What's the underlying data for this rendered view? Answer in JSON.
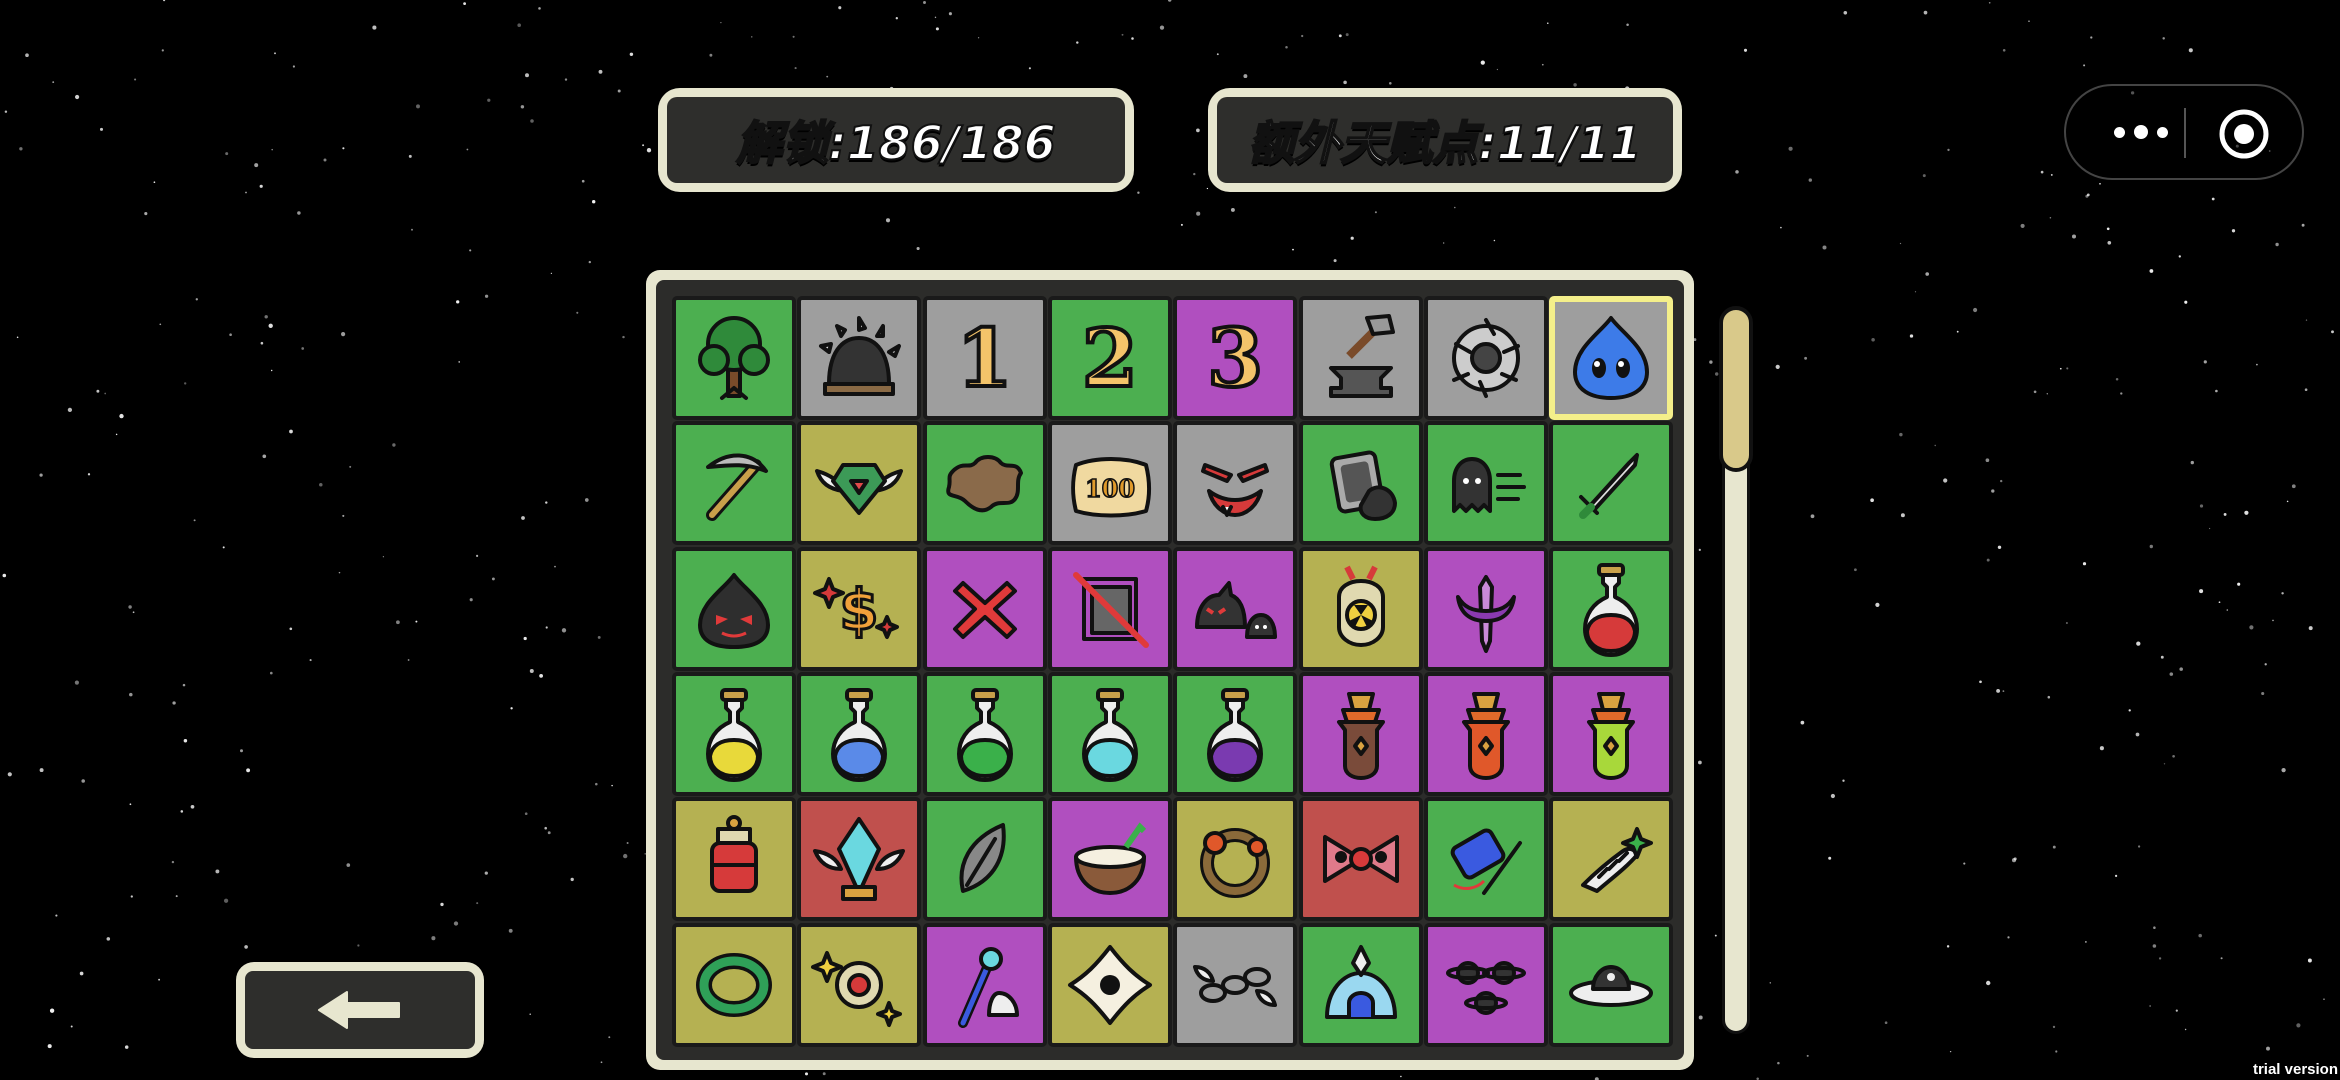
{
  "header": {
    "unlock_label": "解锁:186/186",
    "talent_label": "额外天赋点:11/11"
  },
  "colors": {
    "green": "#4caf50",
    "gray": "#9e9e9e",
    "purple": "#b04fbf",
    "olive": "#b5b152",
    "red": "#c0504d",
    "panel": "#e7e6cf",
    "selected_border": "#f4ef8a"
  },
  "grid": {
    "rows": [
      [
        {
          "icon": "tree-icon",
          "bg": "green"
        },
        {
          "icon": "spiked-helmet-icon",
          "bg": "gray"
        },
        {
          "icon": "number-one-icon",
          "bg": "gray",
          "text": "1"
        },
        {
          "icon": "number-two-icon",
          "bg": "green",
          "text": "2"
        },
        {
          "icon": "number-three-icon",
          "bg": "purple",
          "text": "3"
        },
        {
          "icon": "hammer-anvil-icon",
          "bg": "gray"
        },
        {
          "icon": "saw-blade-icon",
          "bg": "gray"
        },
        {
          "icon": "blue-slime-icon",
          "bg": "gray",
          "selected": true
        }
      ],
      [
        {
          "icon": "pickaxe-icon",
          "bg": "green"
        },
        {
          "icon": "winged-gem-icon",
          "bg": "olive"
        },
        {
          "icon": "hide-pelt-icon",
          "bg": "green"
        },
        {
          "icon": "coin-100-icon",
          "bg": "gray"
        },
        {
          "icon": "evil-grin-icon",
          "bg": "gray"
        },
        {
          "icon": "shield-card-icon",
          "bg": "green"
        },
        {
          "icon": "dashing-ghost-icon",
          "bg": "green"
        },
        {
          "icon": "sword-icon",
          "bg": "green"
        }
      ],
      [
        {
          "icon": "dark-slime-icon",
          "bg": "green"
        },
        {
          "icon": "sparkle-dollar-icon",
          "bg": "olive"
        },
        {
          "icon": "red-x-icon",
          "bg": "purple"
        },
        {
          "icon": "crossed-box-icon",
          "bg": "purple"
        },
        {
          "icon": "shadow-creatures-icon",
          "bg": "purple"
        },
        {
          "icon": "nuke-bomb-icon",
          "bg": "olive"
        },
        {
          "icon": "horned-dagger-icon",
          "bg": "purple"
        },
        {
          "icon": "red-potion-icon",
          "bg": "green"
        }
      ],
      [
        {
          "icon": "yellow-potion-icon",
          "bg": "green"
        },
        {
          "icon": "blue-potion-icon",
          "bg": "green"
        },
        {
          "icon": "green-potion-icon",
          "bg": "green"
        },
        {
          "icon": "cyan-potion-icon",
          "bg": "green"
        },
        {
          "icon": "purple-potion-icon",
          "bg": "green"
        },
        {
          "icon": "brown-elixir-icon",
          "bg": "purple"
        },
        {
          "icon": "orange-elixir-icon",
          "bg": "purple"
        },
        {
          "icon": "lime-elixir-icon",
          "bg": "purple"
        }
      ],
      [
        {
          "icon": "red-lantern-potion-icon",
          "bg": "olive"
        },
        {
          "icon": "winged-crystal-flask-icon",
          "bg": "red"
        },
        {
          "icon": "feather-leaf-icon",
          "bg": "green"
        },
        {
          "icon": "coconut-icon",
          "bg": "purple"
        },
        {
          "icon": "flower-wreath-icon",
          "bg": "olive"
        },
        {
          "icon": "skull-bowtie-icon",
          "bg": "red"
        },
        {
          "icon": "thread-needle-icon",
          "bg": "green"
        },
        {
          "icon": "bandaged-arm-icon",
          "bg": "olive"
        }
      ],
      [
        {
          "icon": "green-ring-icon",
          "bg": "olive"
        },
        {
          "icon": "star-amulet-icon",
          "bg": "olive"
        },
        {
          "icon": "wizard-staff-icon",
          "bg": "purple"
        },
        {
          "icon": "all-seeing-eye-icon",
          "bg": "olive"
        },
        {
          "icon": "winged-chain-icon",
          "bg": "gray"
        },
        {
          "icon": "crystal-igloo-icon",
          "bg": "green"
        },
        {
          "icon": "planets-icon",
          "bg": "purple"
        },
        {
          "icon": "flying-saucer-icon",
          "bg": "green"
        }
      ]
    ]
  },
  "footer": {
    "trial_label": "trial version"
  }
}
